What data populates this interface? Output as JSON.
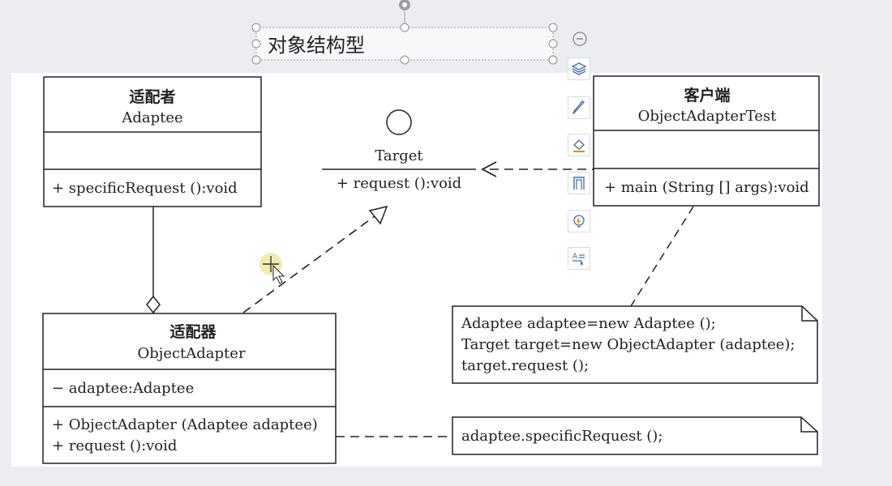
{
  "title_label": "对象结构型",
  "adaptee": {
    "cn": "适配者",
    "en": "Adaptee",
    "method": "+ specificRequest ():void"
  },
  "target": {
    "name": "Target",
    "method": "+ request ():void"
  },
  "client": {
    "cn": "客户端",
    "en": "ObjectAdapterTest",
    "method": "+ main (String [] args):void"
  },
  "adapter": {
    "cn": "适配器",
    "en": "ObjectAdapter",
    "attr": "− adaptee:Adaptee",
    "method1": "+ ObjectAdapter (Adaptee adaptee)",
    "method2": "+ request ():void"
  },
  "note_client": {
    "line1": "Adaptee adaptee=new Adaptee ();",
    "line2": "Target target=new ObjectAdapter (adaptee);",
    "line3": "target.request ();"
  },
  "note_adapter": {
    "line1": "adaptee.specificRequest ();"
  },
  "toolbar": {
    "icons": [
      "minus-circle-icon",
      "layers-icon",
      "brush-icon",
      "fill-icon",
      "border-icon",
      "lightbulb-icon",
      "text-cursor-icon"
    ]
  },
  "colors": {
    "diagram_line": "#222222",
    "icon_blue": "#3a6fb0",
    "icon_orange": "#e08a1e",
    "cursor_highlight": "#f1e9a6"
  }
}
